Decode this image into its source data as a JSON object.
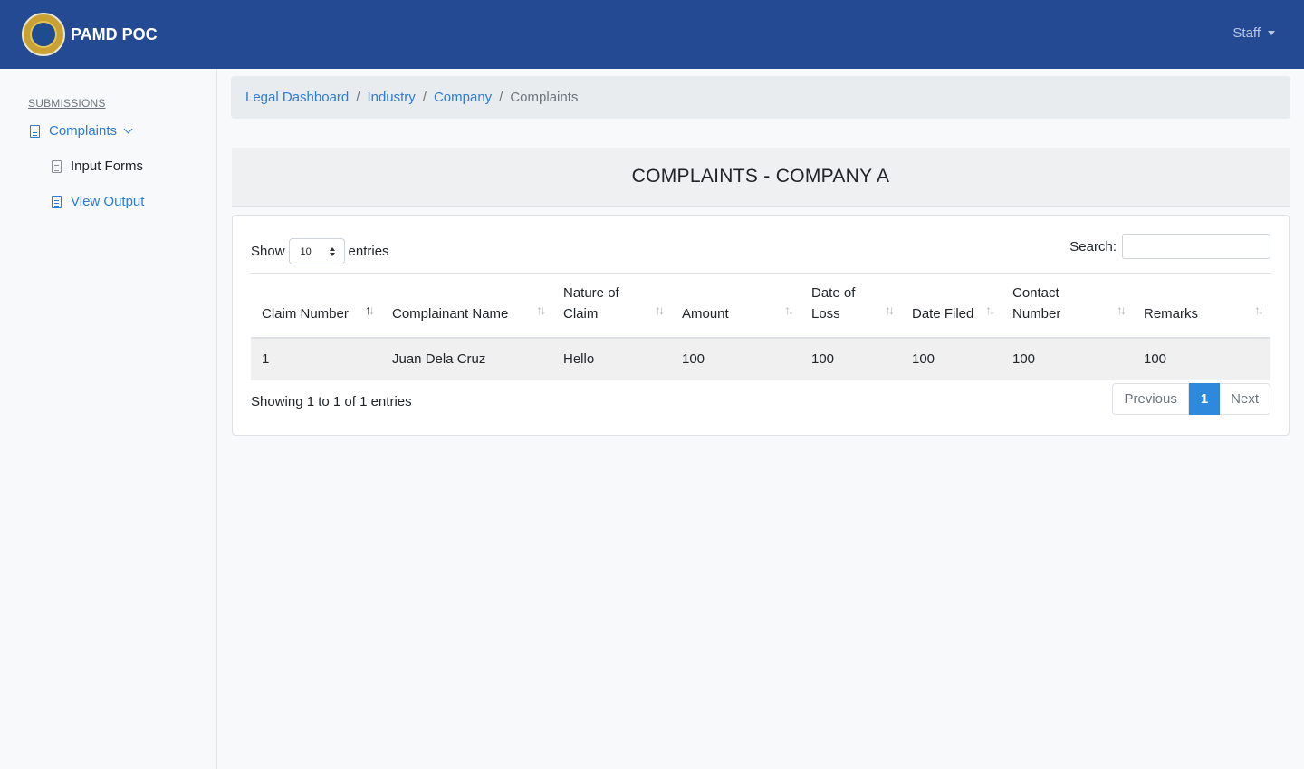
{
  "navbar": {
    "brand": "PAMD POC",
    "user_menu": "Staff"
  },
  "sidebar": {
    "heading": "SUBMISSIONS",
    "items": [
      {
        "label": "Complaints",
        "icon": "document-icon",
        "expanded": true
      },
      {
        "label": "Input Forms",
        "icon": "document-icon"
      },
      {
        "label": "View Output",
        "icon": "document-icon",
        "active": true
      }
    ]
  },
  "breadcrumb": {
    "items": [
      "Legal Dashboard",
      "Industry",
      "Company"
    ],
    "current": "Complaints",
    "separator": "/"
  },
  "page": {
    "title": "COMPLAINTS - COMPANY A"
  },
  "table_controls": {
    "show_label": "Show",
    "entries_value": "10",
    "entries_label": "entries",
    "search_label": "Search:",
    "search_value": ""
  },
  "table": {
    "headers": [
      "Claim Number",
      "Complainant Name",
      "Nature of Claim",
      "Amount",
      "Date of Loss",
      "Date Filed",
      "Contact Number",
      "Remarks"
    ],
    "rows": [
      [
        "1",
        "Juan Dela Cruz",
        "Hello",
        "100",
        "100",
        "100",
        "100",
        "100"
      ]
    ]
  },
  "footer": {
    "info": "Showing 1 to 1 of 1 entries",
    "pagination": {
      "previous": "Previous",
      "current": "1",
      "next": "Next"
    }
  },
  "colors": {
    "navbar": "#254a94",
    "link": "#2e7bd6",
    "active_page": "#2e88dc"
  }
}
